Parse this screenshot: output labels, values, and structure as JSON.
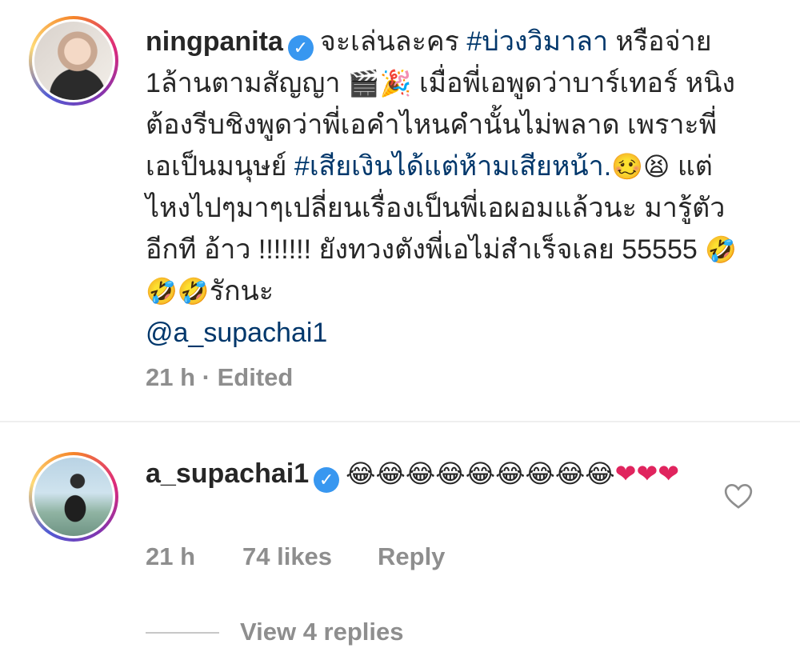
{
  "comment1": {
    "username": "ningpanita",
    "text_a": "จะเล่นละคร ",
    "hashtag1": "#บ่วงวิมาลา",
    "text_b": " หรือจ่าย 1ล้านตามสัญญา ",
    "emoji_a": "🎬🎉",
    "text_c": " เมื่อพี่เอพูดว่าบาร์เทอร์ หนิงต้องรีบชิงพูดว่าพี่เอคำไหนคำนั้นไม่พลาด เพราะพี่เอเป็นมนุษย์ ",
    "hashtag2": "#เสียเงินได้แต่ห้ามเสียหน้า.",
    "emoji_b": "🥴😫",
    "text_d": " แต่ไหงไปๆมาๆเปลี่ยนเรื่องเป็นพี่เอผอมแล้วนะ มารู้ตัวอีกที อ้าว !!!!!!! ยังทวงตังพี่เอไม่สำเร็จเลย 55555 ",
    "emoji_c": "🤣🤣🤣",
    "text_e": "รักนะ",
    "mention": "@a_supachai1",
    "time": "21 h",
    "edited": "· Edited"
  },
  "comment2": {
    "username": "a_supachai1",
    "emoji_line": "😂😂😂😂😂😂😂😂😂",
    "hearts": "❤❤❤",
    "time": "21 h",
    "likes": "74 likes",
    "reply": "Reply",
    "view_replies": "View 4 replies"
  },
  "icons": {
    "verified": "verified-badge",
    "like": "heart-outline-icon"
  },
  "colors": {
    "link": "#00376b",
    "verified": "#3897f0",
    "meta": "#8e8e8e",
    "heart": "#e0245e"
  }
}
